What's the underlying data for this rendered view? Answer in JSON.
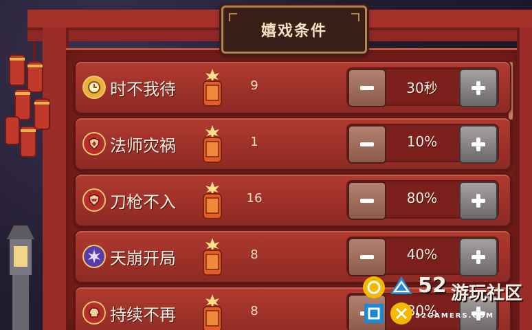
{
  "title": "嬉戏条件",
  "rows": [
    {
      "name": "时不我待",
      "count": "9",
      "value": "30秒",
      "icon": "clock-icon",
      "icon_color": "#e8b13a"
    },
    {
      "name": "法师灾祸",
      "count": "1",
      "value": "10%",
      "icon": "mage-shield-icon",
      "icon_color": "#b72c2c"
    },
    {
      "name": "刀枪不入",
      "count": "16",
      "value": "80%",
      "icon": "armor-shield-icon",
      "icon_color": "#b72c2c"
    },
    {
      "name": "天崩开局",
      "count": "8",
      "value": "40%",
      "icon": "burst-icon",
      "icon_color": "#5a3ca8"
    },
    {
      "name": "持续不再",
      "count": "8",
      "value": "80%",
      "icon": "helmet-icon",
      "icon_color": "#b72c2c"
    }
  ],
  "watermark": {
    "number": "52",
    "text": "游玩社区",
    "url": "52GAMERS.COM"
  }
}
